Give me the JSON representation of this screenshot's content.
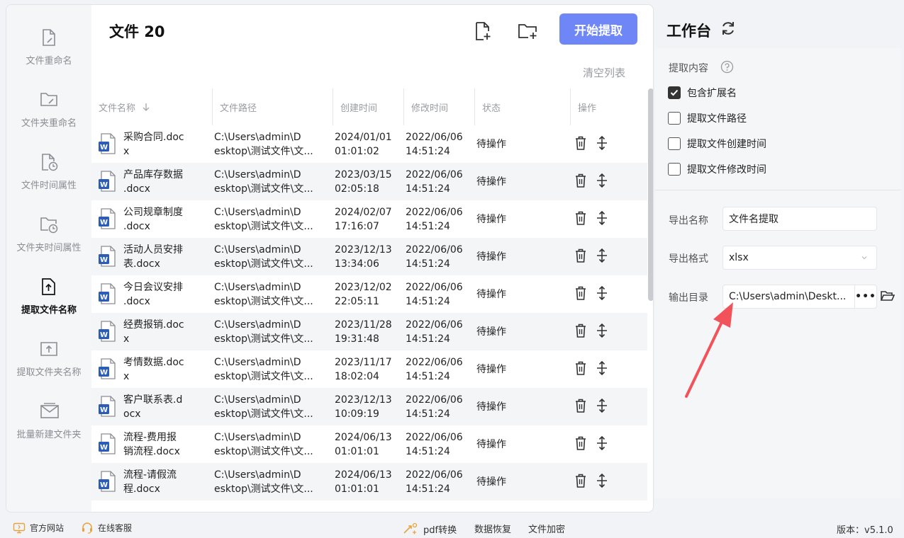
{
  "sidebar": {
    "items": [
      {
        "label": "文件重命名",
        "icon": "file-edit-icon"
      },
      {
        "label": "文件夹重命名",
        "icon": "folder-edit-icon"
      },
      {
        "label": "文件时间属性",
        "icon": "file-clock-icon"
      },
      {
        "label": "文件夹时间属性",
        "icon": "folder-clock-icon"
      },
      {
        "label": "提取文件名称",
        "icon": "file-upload-icon",
        "active": true
      },
      {
        "label": "提取文件夹名称",
        "icon": "folder-upload-icon"
      },
      {
        "label": "批量新建文件夹",
        "icon": "folder-batch-icon"
      }
    ]
  },
  "header": {
    "title": "文件 20",
    "start_label": "开始提取",
    "clear_label": "清空列表",
    "add_file_icon": "add-file-icon",
    "add_folder_icon": "add-folder-icon"
  },
  "table": {
    "columns": [
      "文件名称",
      "文件路径",
      "创建时间",
      "修改时间",
      "状态",
      "操作"
    ],
    "rows": [
      {
        "name": "采购合同.docx",
        "path": "C:\\Users\\admin\\Desktop\\测试文件\\文...",
        "created": [
          "2024/01/01",
          "01:01:02"
        ],
        "modified": [
          "2022/06/06",
          "14:51:24"
        ],
        "status": "待操作"
      },
      {
        "name": "产品库存数据.docx",
        "path": "C:\\Users\\admin\\Desktop\\测试文件\\文...",
        "created": [
          "2023/03/15",
          "02:05:18"
        ],
        "modified": [
          "2022/06/06",
          "14:51:24"
        ],
        "status": "待操作"
      },
      {
        "name": "公司规章制度.docx",
        "path": "C:\\Users\\admin\\Desktop\\测试文件\\文...",
        "created": [
          "2024/02/07",
          "17:16:07"
        ],
        "modified": [
          "2022/06/06",
          "14:51:24"
        ],
        "status": "待操作"
      },
      {
        "name": "活动人员安排表.docx",
        "path": "C:\\Users\\admin\\Desktop\\测试文件\\文...",
        "created": [
          "2023/12/13",
          "13:34:06"
        ],
        "modified": [
          "2022/06/06",
          "14:51:24"
        ],
        "status": "待操作"
      },
      {
        "name": "今日会议安排.docx",
        "path": "C:\\Users\\admin\\Desktop\\测试文件\\文...",
        "created": [
          "2023/12/02",
          "22:05:11"
        ],
        "modified": [
          "2022/06/06",
          "14:51:24"
        ],
        "status": "待操作"
      },
      {
        "name": "经费报销.docx",
        "path": "C:\\Users\\admin\\Desktop\\测试文件\\文...",
        "created": [
          "2023/11/28",
          "19:31:48"
        ],
        "modified": [
          "2022/06/06",
          "14:51:24"
        ],
        "status": "待操作"
      },
      {
        "name": "考情数据.docx",
        "path": "C:\\Users\\admin\\Desktop\\测试文件\\文...",
        "created": [
          "2023/11/17",
          "18:02:04"
        ],
        "modified": [
          "2022/06/06",
          "14:51:24"
        ],
        "status": "待操作"
      },
      {
        "name": "客户联系表.docx",
        "path": "C:\\Users\\admin\\Desktop\\测试文件\\文...",
        "created": [
          "2023/12/13",
          "10:09:19"
        ],
        "modified": [
          "2022/06/06",
          "14:51:24"
        ],
        "status": "待操作"
      },
      {
        "name": "流程-费用报销流程.docx",
        "path": "C:\\Users\\admin\\Desktop\\测试文件\\文...",
        "created": [
          "2024/06/13",
          "01:01:01"
        ],
        "modified": [
          "2022/06/06",
          "14:51:24"
        ],
        "status": "待操作"
      },
      {
        "name": "流程-请假流程.docx",
        "path": "C:\\Users\\admin\\Desktop\\测试文件\\文...",
        "created": [
          "2024/06/13",
          "01:01:01"
        ],
        "modified": [
          "2022/06/06",
          "14:51:24"
        ],
        "status": "待操作"
      }
    ]
  },
  "workspace": {
    "title": "工作台",
    "extract_label": "提取内容",
    "options": [
      {
        "label": "包含扩展名",
        "checked": true
      },
      {
        "label": "提取文件路径",
        "checked": false
      },
      {
        "label": "提取文件创建时间",
        "checked": false
      },
      {
        "label": "提取文件修改时间",
        "checked": false
      }
    ],
    "export_name_label": "导出名称",
    "export_name_value": "文件名提取",
    "export_format_label": "导出格式",
    "export_format_value": "xlsx",
    "output_dir_label": "输出目录",
    "output_dir_value": "C:\\Users\\admin\\Deskt...",
    "more_label": "•••"
  },
  "footer": {
    "website": "官方网站",
    "support": "在线客服",
    "pdf": "pdf转换",
    "recovery": "数据恢复",
    "encrypt": "文件加密",
    "version": "版本：v5.1.0"
  },
  "colors": {
    "accent": "#6f86f7",
    "word_blue": "#2b5cb8",
    "arrow": "#f2535b"
  }
}
